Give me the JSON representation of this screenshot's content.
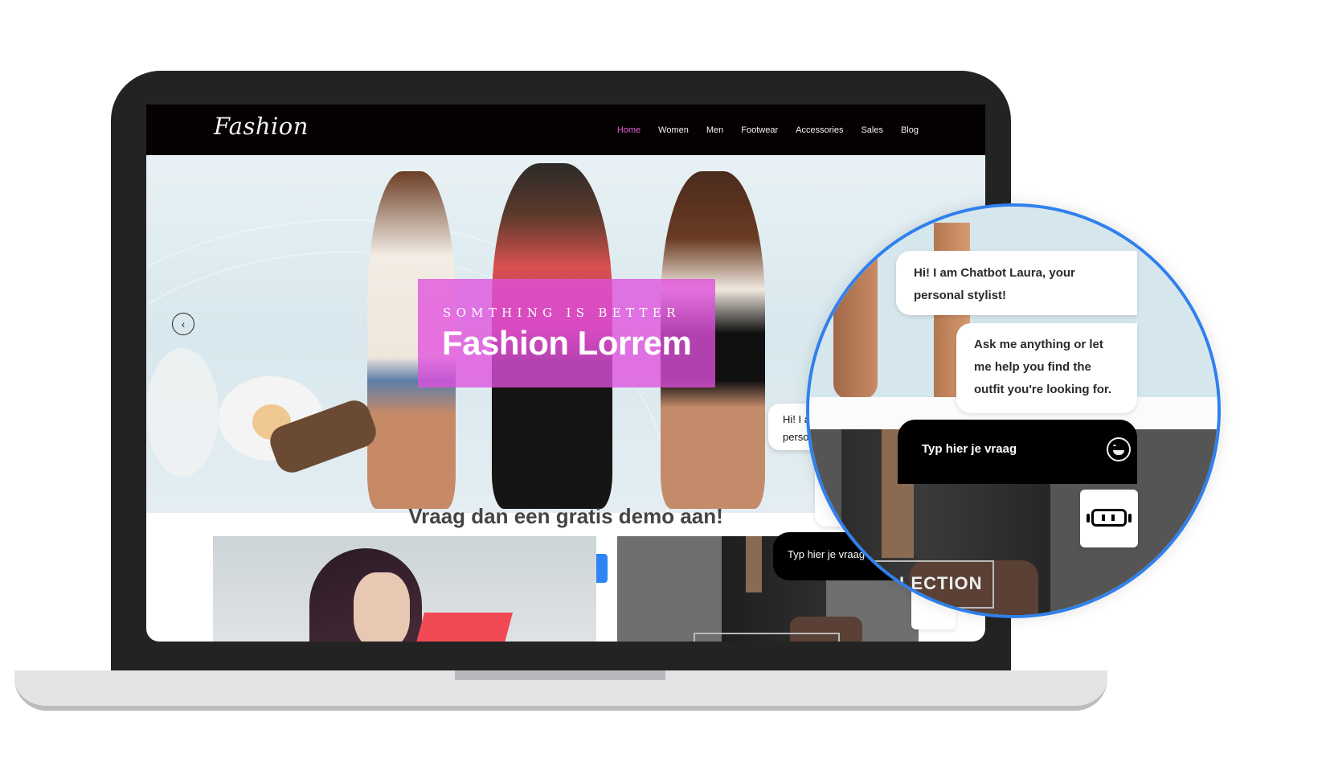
{
  "site": {
    "logo": "Fashion",
    "nav": [
      {
        "label": "Home",
        "active": true
      },
      {
        "label": "Women",
        "active": false
      },
      {
        "label": "Men",
        "active": false
      },
      {
        "label": "Footwear",
        "active": false
      },
      {
        "label": "Accessories",
        "active": false
      },
      {
        "label": "Sales",
        "active": false
      },
      {
        "label": "Blog",
        "active": false
      }
    ],
    "accent_color": "#e060d8"
  },
  "hero": {
    "subtitle": "SOMTHING IS BETTER",
    "title": "Fashion Lorrem",
    "prev_icon": "chevron-left-icon"
  },
  "section": {
    "title": "Vraag dan een gratis demo aan!"
  },
  "cards": {
    "right_button": "VIEW COLLECTION"
  },
  "chatbot": {
    "greeting": "Hi! I am Chatbot Laura, your personal stylist!",
    "greeting_line1": "Hi! I am Chatbot Laura, your",
    "greeting_line2": "personal stylist!",
    "greeting_truncated_1": "Hi! I a",
    "greeting_truncated_2": "perso",
    "message2_line1": "Ask me anything or let",
    "message2_line2": "me help you find the",
    "message2_line3": "outfit you're looking for.",
    "input_placeholder": "Typ hier je vraag",
    "emoji_icon": "smiley-icon",
    "bot_icon": "robot-icon",
    "collection_label": "LECTION",
    "border_color": "#2f80ed"
  }
}
